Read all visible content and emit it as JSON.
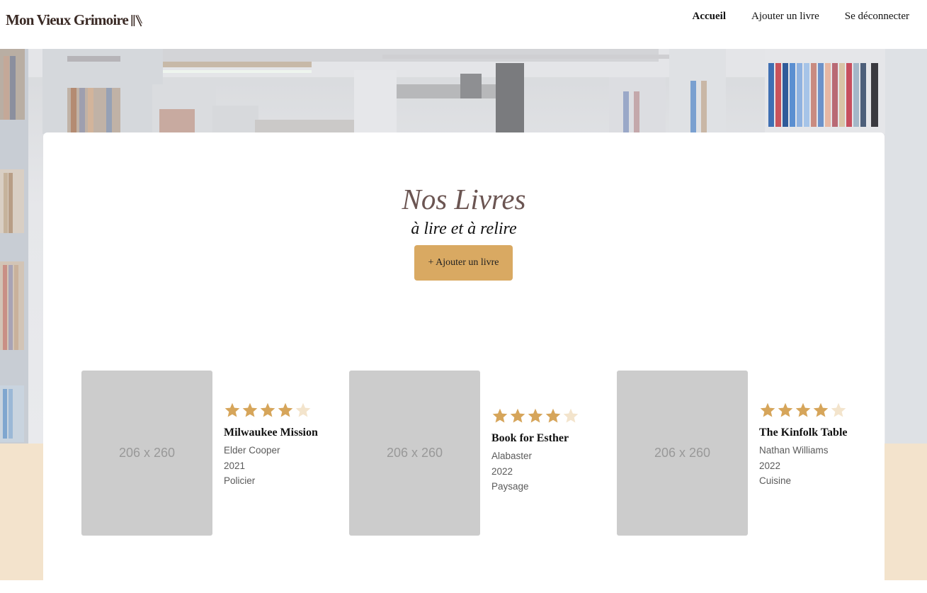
{
  "header": {
    "logo_text": "Mon Vieux Grimoire",
    "nav": [
      {
        "label": "Accueil",
        "active": true
      },
      {
        "label": "Ajouter un livre",
        "active": false
      },
      {
        "label": "Se déconnecter",
        "active": false
      }
    ]
  },
  "main": {
    "title": "Nos Livres",
    "subtitle": "à lire et à relire",
    "add_button_label": "+ Ajouter un livre"
  },
  "books": [
    {
      "placeholder": "206 x 260",
      "rating": 4,
      "title": "Milwaukee Mission",
      "author": "Elder Cooper",
      "year": "2021",
      "genre": "Policier"
    },
    {
      "placeholder": "206 x 260",
      "rating": 4,
      "title": "Book for Esther",
      "author": "Alabaster",
      "year": "2022",
      "genre": "Paysage"
    },
    {
      "placeholder": "206 x 260",
      "rating": 4,
      "title": "The Kinfolk Table",
      "author": "Nathan Williams",
      "year": "2022",
      "genre": "Cuisine"
    }
  ],
  "colors": {
    "accent": "#d9a962",
    "star_filled": "#d6a55a",
    "star_empty": "#f3e4cc",
    "title_color": "#6b5552",
    "beige_band": "#f3e3cc"
  }
}
